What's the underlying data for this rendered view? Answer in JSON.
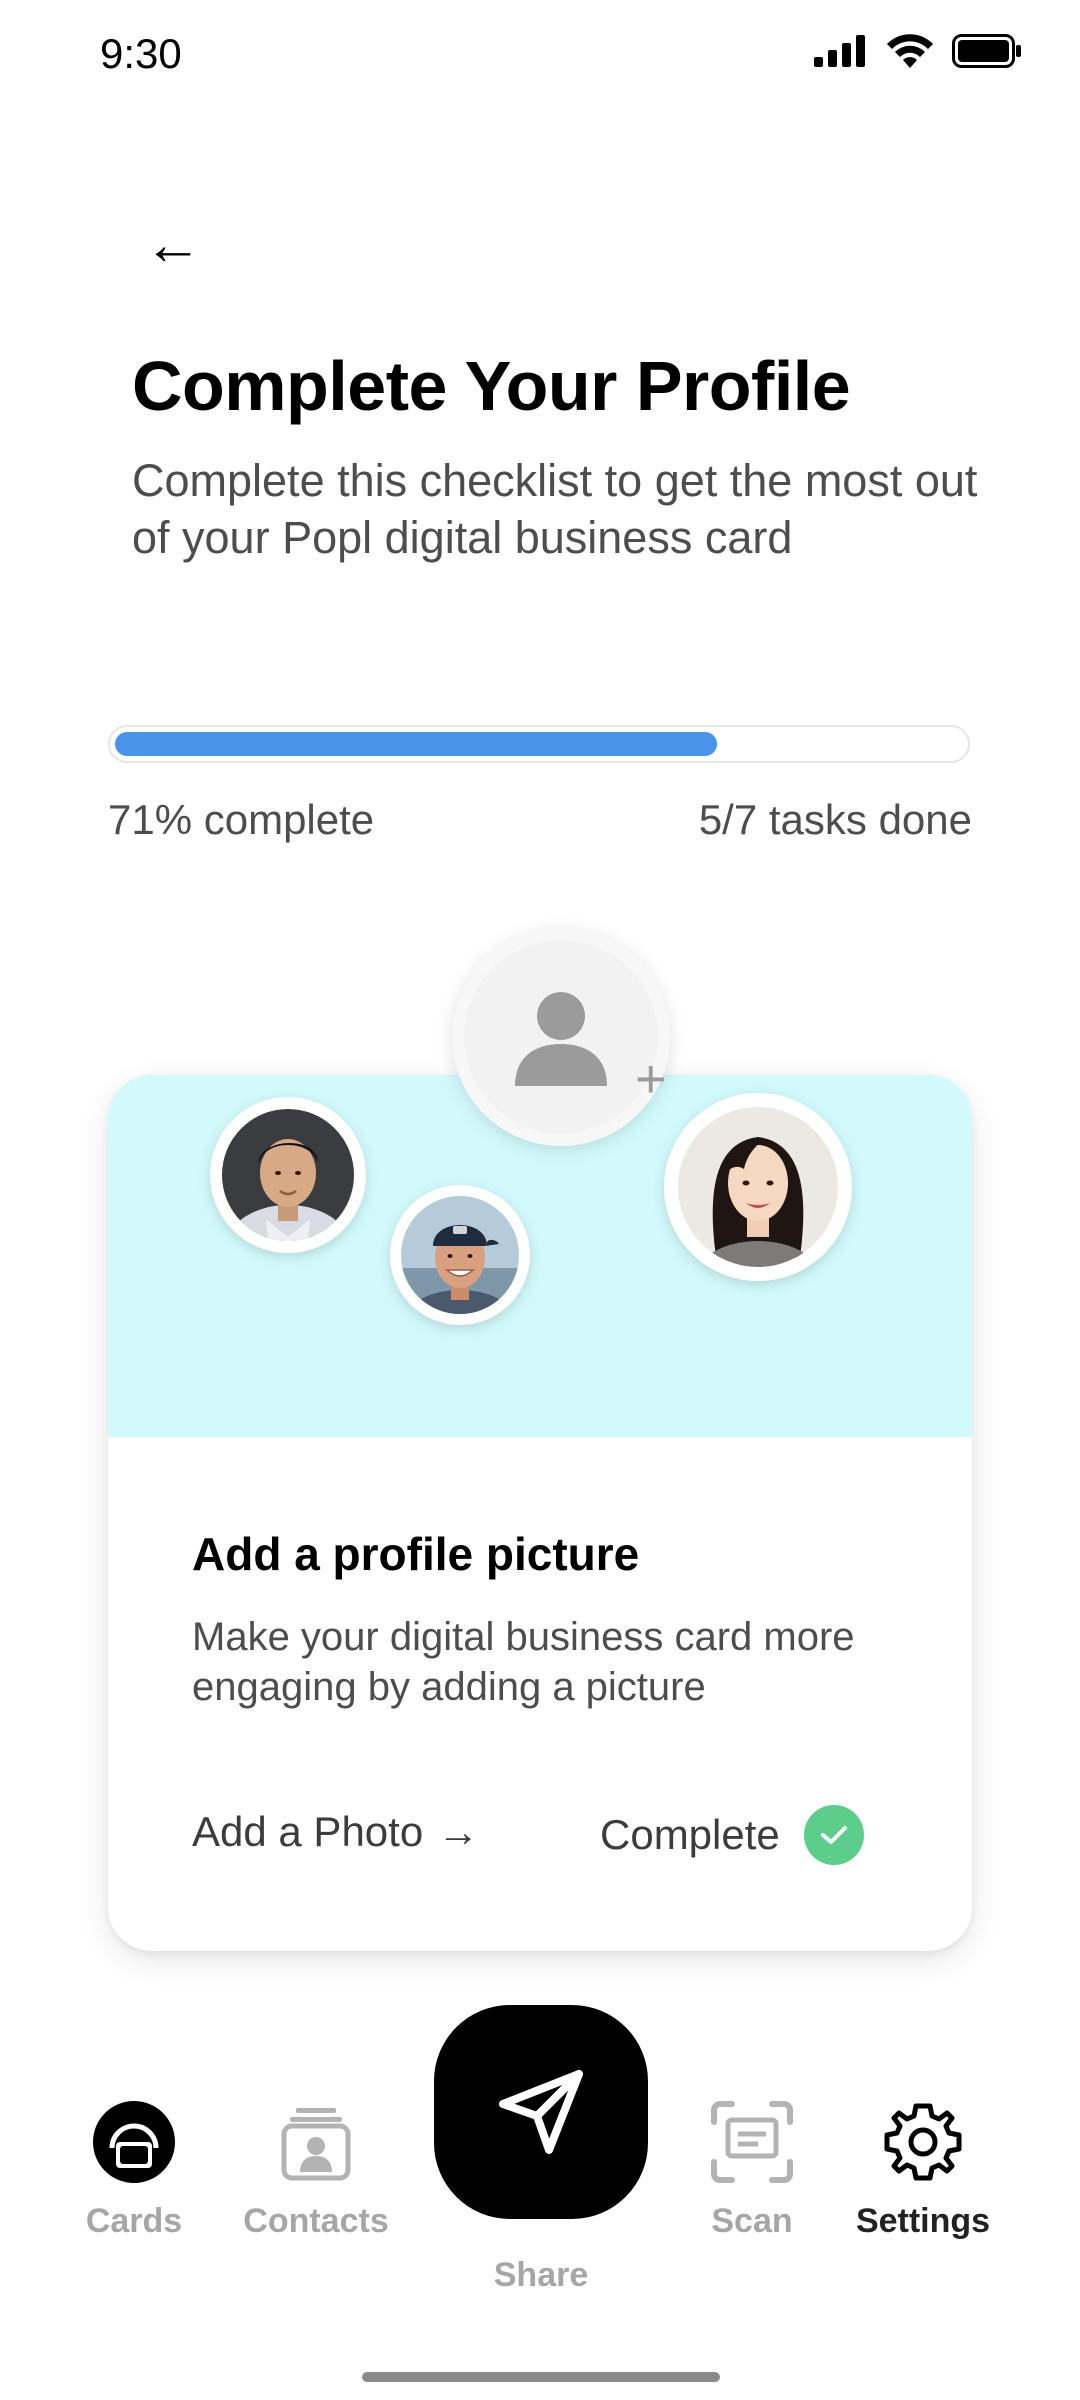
{
  "status_bar": {
    "time": "9:30"
  },
  "header": {
    "back_icon": "arrow-left-icon",
    "back_glyph": "←",
    "title": "Complete Your Profile",
    "subtitle": "Complete this checklist to get the most out of your Popl digital business card"
  },
  "progress": {
    "fraction": 0.71,
    "percent_label": "71% complete",
    "tasks_label": "5/7 tasks done",
    "fill_color": "#4a93ea"
  },
  "card": {
    "banner_color": "#d2fafc",
    "title": "Add a profile picture",
    "description": "Make your digital business card more engaging by adding a picture",
    "action_label": "Add a Photo",
    "action_arrow": "→",
    "status_label": "Complete",
    "status_color": "#5ccd8b",
    "placeholder_plus": "+"
  },
  "nav": {
    "items": [
      {
        "label": "Cards",
        "icon": "cards-icon",
        "active": false
      },
      {
        "label": "Contacts",
        "icon": "contacts-icon",
        "active": false
      },
      {
        "label": "Share",
        "icon": "send-icon",
        "active": false
      },
      {
        "label": "Scan",
        "icon": "scan-icon",
        "active": false
      },
      {
        "label": "Settings",
        "icon": "gear-icon",
        "active": true
      }
    ]
  }
}
